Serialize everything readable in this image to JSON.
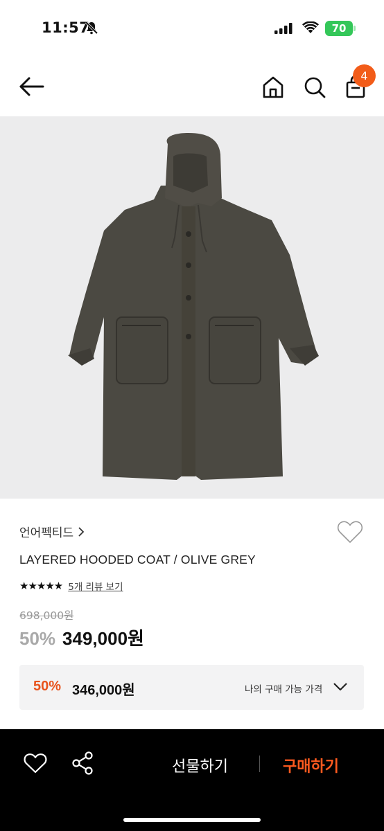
{
  "status_bar": {
    "time": "11:57",
    "battery": "70"
  },
  "header": {
    "cart_count": "4"
  },
  "product": {
    "brand": "언어펙티드",
    "name": "LAYERED HOODED COAT / OLIVE GREY",
    "rating_stars": "★★★★★",
    "review_link": "5개 리뷰 보기",
    "original_price": "698,000원",
    "discount_rate": "50%",
    "sale_price": "349,000원"
  },
  "my_price": {
    "discount_rate": "50%",
    "price": "346,000원",
    "label": "나의 구매 가능 가격"
  },
  "bottom_bar": {
    "gift_label": "선물하기",
    "buy_label": "구매하기"
  },
  "colors": {
    "accent": "#f25c19",
    "buy": "#ff5a1f",
    "battery": "#34c759"
  }
}
